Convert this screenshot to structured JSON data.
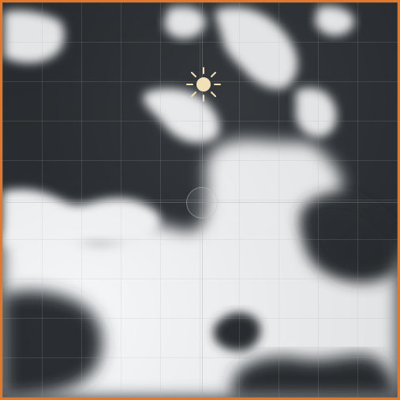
{
  "scene": {
    "name": "cloud-noise-viewport",
    "icons": {
      "sun": "sun-icon",
      "center_handle": "center-handle-icon"
    },
    "colors": {
      "frame": "#e3782a",
      "background_dark": "#2b2f33",
      "cloud_light": "#f4f6f8",
      "grid": "#b4b4b4",
      "sun": "#f2e0b8"
    }
  }
}
